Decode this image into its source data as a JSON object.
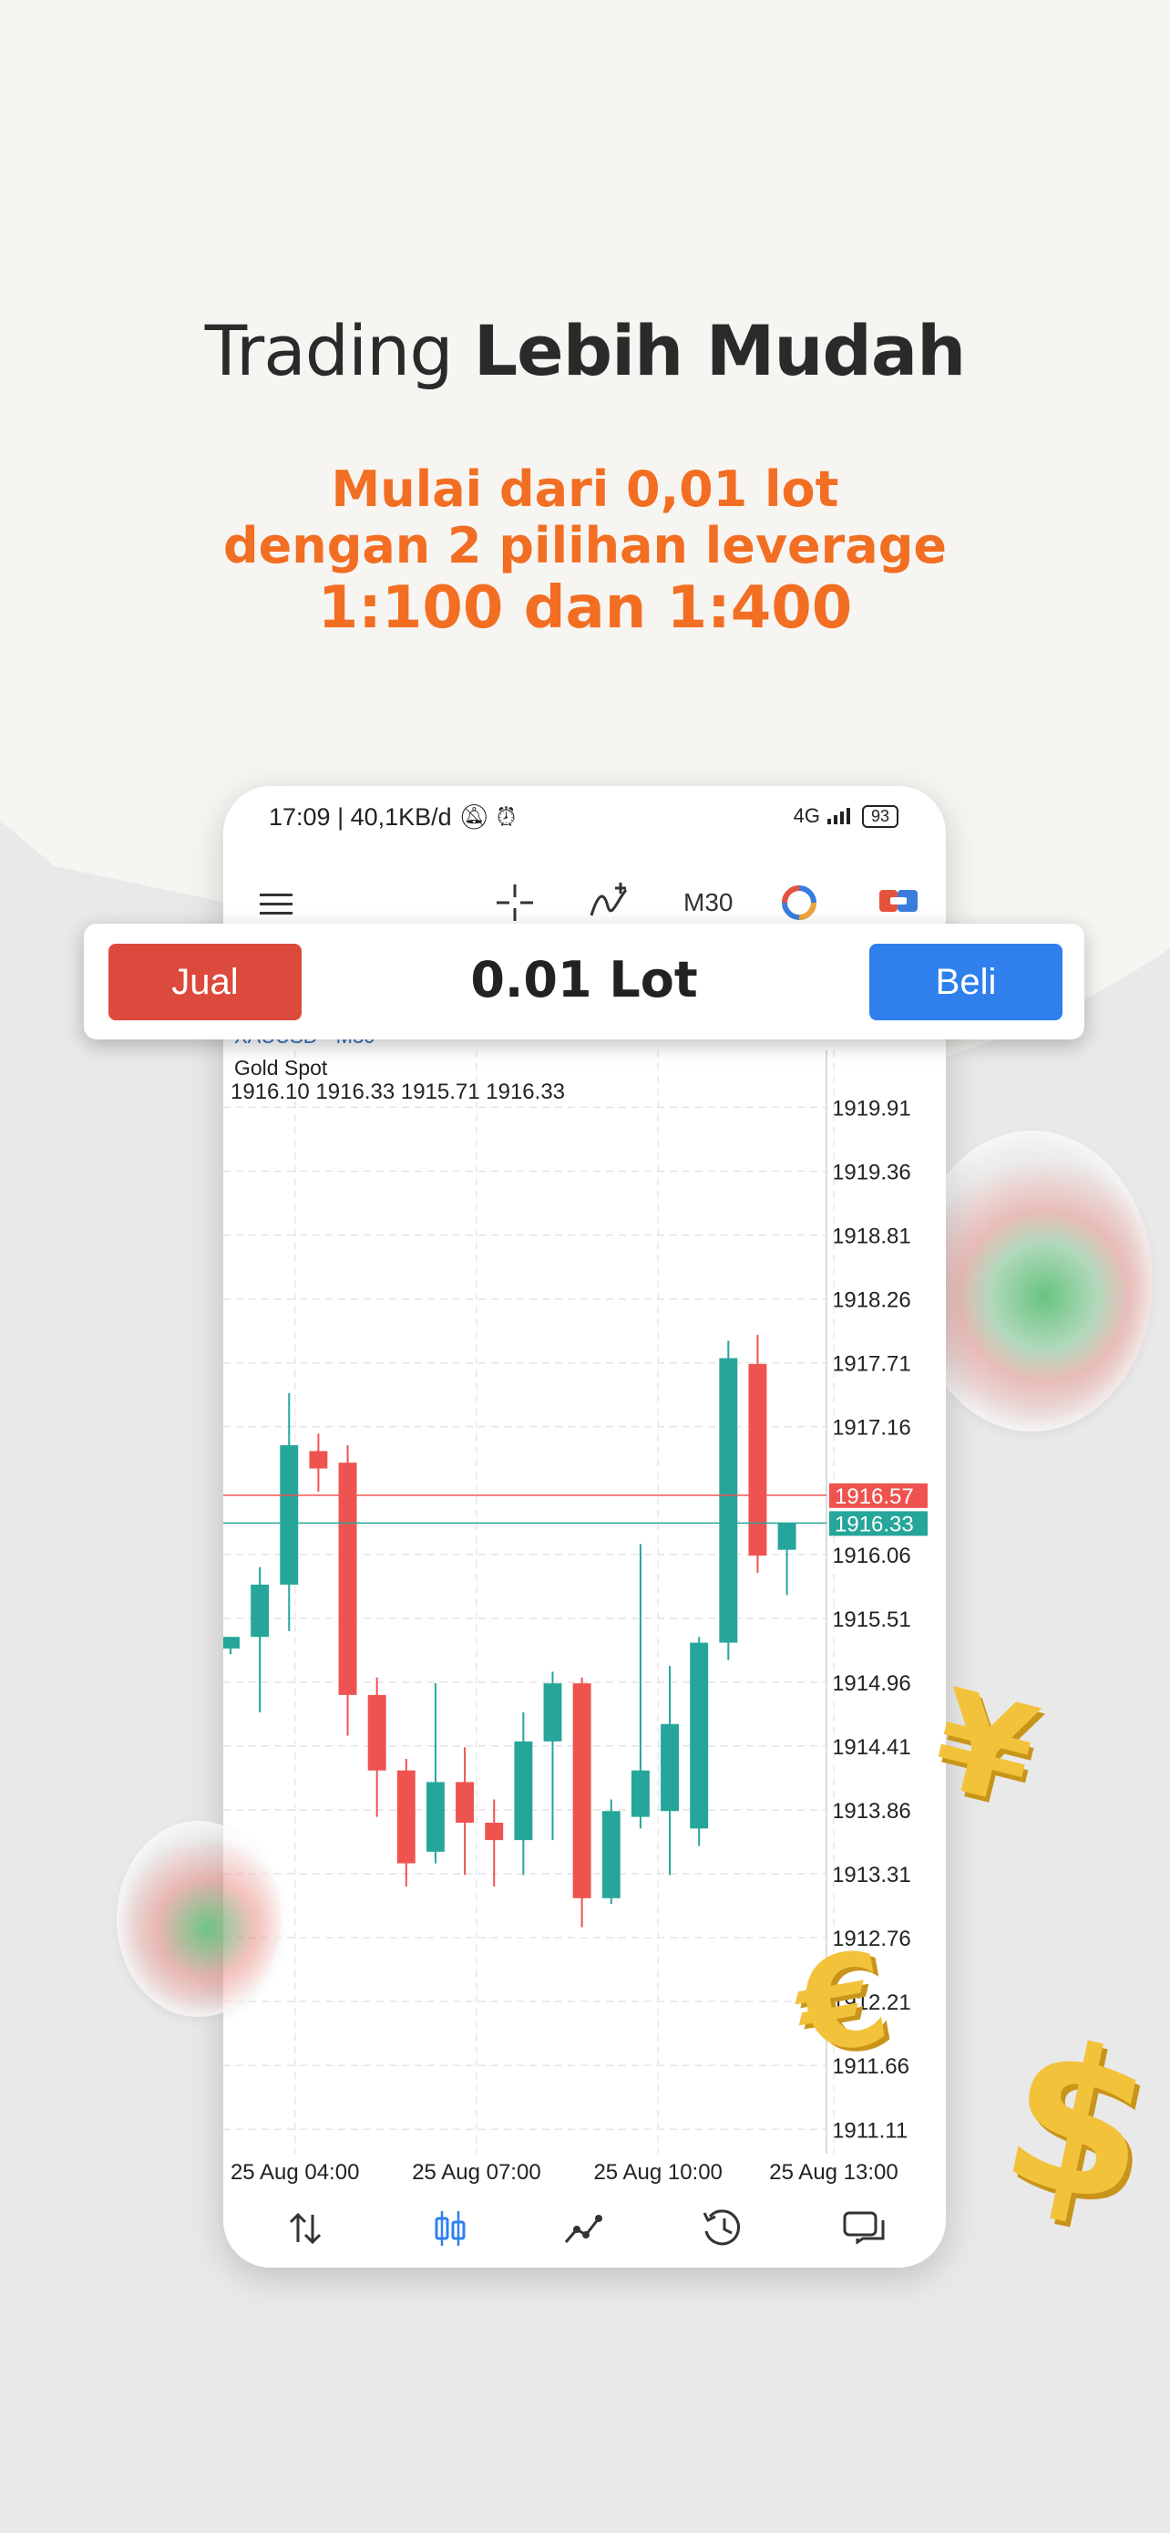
{
  "hero": {
    "title_light": "Trading ",
    "title_bold": "Lebih Mudah",
    "subtitle_line1": "Mulai dari 0,01 lot",
    "subtitle_line2": "dengan 2 pilihan leverage",
    "subtitle_line3": "1:100 dan 1:400"
  },
  "status_bar": {
    "time_speed": "17:09 | 40,1KB/d",
    "network": "4G",
    "battery": "93"
  },
  "toolbar": {
    "timeframe": "M30"
  },
  "trade_bar": {
    "sell_label": "Jual",
    "lot_label": "0.01 Lot",
    "buy_label": "Beli"
  },
  "chart_header": {
    "symbol": "XAUUSD • M30",
    "symbol_name": "Gold Spot",
    "ohlc": "1916.10 1916.33 1915.71 1916.33"
  },
  "chart_data": {
    "type": "candlestick",
    "price_axis_labels": [
      "1919.91",
      "1919.36",
      "1918.81",
      "1918.26",
      "1917.71",
      "1917.16",
      "1916.06",
      "1915.51",
      "1914.96",
      "1914.41",
      "1913.86",
      "1913.31",
      "1912.76",
      "1912.21",
      "1911.66",
      "1911.11"
    ],
    "time_axis_labels": [
      "25 Aug 04:00",
      "25 Aug 07:00",
      "25 Aug 10:00",
      "25 Aug 13:00"
    ],
    "ask_line": "1916.57",
    "bid_line": "1916.33",
    "ylim": [
      1910.9,
      1920.4
    ],
    "up_color": "#26a69a",
    "down_color": "#ef5350",
    "candles": [
      {
        "o": 1915.25,
        "h": 1915.35,
        "l": 1915.2,
        "c": 1915.35
      },
      {
        "o": 1915.35,
        "h": 1915.95,
        "l": 1914.7,
        "c": 1915.8
      },
      {
        "o": 1915.8,
        "h": 1917.45,
        "l": 1915.4,
        "c": 1917.0
      },
      {
        "o": 1916.95,
        "h": 1917.1,
        "l": 1916.6,
        "c": 1916.8
      },
      {
        "o": 1916.85,
        "h": 1917.0,
        "l": 1914.5,
        "c": 1914.85
      },
      {
        "o": 1914.85,
        "h": 1915.0,
        "l": 1913.8,
        "c": 1914.2
      },
      {
        "o": 1914.2,
        "h": 1914.3,
        "l": 1913.2,
        "c": 1913.4
      },
      {
        "o": 1913.5,
        "h": 1914.95,
        "l": 1913.4,
        "c": 1914.1
      },
      {
        "o": 1914.1,
        "h": 1914.4,
        "l": 1913.3,
        "c": 1913.75
      },
      {
        "o": 1913.75,
        "h": 1913.95,
        "l": 1913.2,
        "c": 1913.6
      },
      {
        "o": 1913.6,
        "h": 1914.7,
        "l": 1913.3,
        "c": 1914.45
      },
      {
        "o": 1914.45,
        "h": 1915.05,
        "l": 1913.6,
        "c": 1914.95
      },
      {
        "o": 1914.95,
        "h": 1915.0,
        "l": 1912.85,
        "c": 1913.1
      },
      {
        "o": 1913.1,
        "h": 1913.95,
        "l": 1913.05,
        "c": 1913.85
      },
      {
        "o": 1913.8,
        "h": 1916.15,
        "l": 1913.7,
        "c": 1914.2
      },
      {
        "o": 1913.85,
        "h": 1915.1,
        "l": 1913.3,
        "c": 1914.6
      },
      {
        "o": 1913.7,
        "h": 1915.35,
        "l": 1913.55,
        "c": 1915.3
      },
      {
        "o": 1915.3,
        "h": 1917.9,
        "l": 1915.15,
        "c": 1917.75
      },
      {
        "o": 1917.7,
        "h": 1917.95,
        "l": 1915.9,
        "c": 1916.05
      },
      {
        "o": 1916.1,
        "h": 1916.33,
        "l": 1915.71,
        "c": 1916.33
      }
    ]
  },
  "bottom_nav": {
    "icons": [
      "quotes-icon",
      "chart-icon",
      "trade-icon",
      "history-icon",
      "messages-icon"
    ]
  }
}
